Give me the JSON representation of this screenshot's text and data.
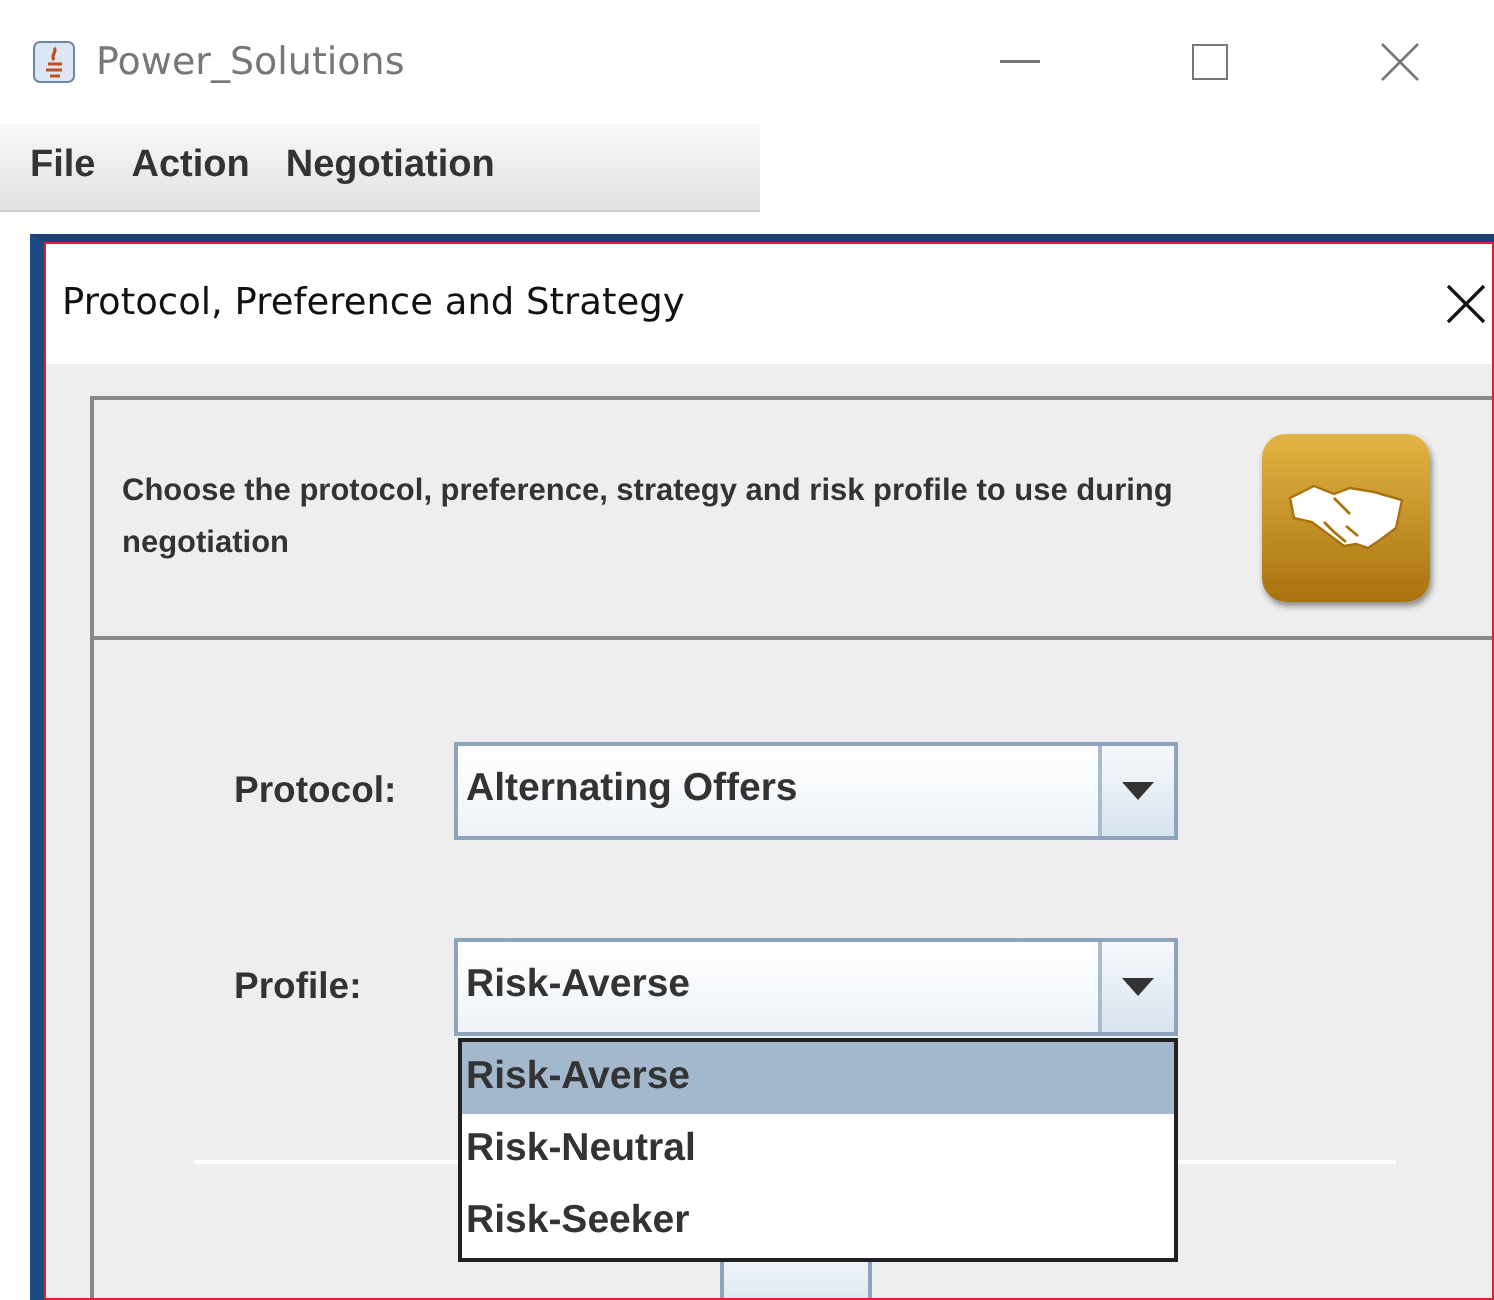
{
  "window": {
    "title": "Power_Solutions"
  },
  "menu": [
    "File",
    "Action",
    "Negotiation"
  ],
  "dialog": {
    "title": "Protocol, Preference and Strategy",
    "description": "Choose the protocol, preference, strategy and risk profile to use during negotiation",
    "fields": [
      {
        "label": "Protocol:",
        "value": "Alternating Offers"
      },
      {
        "label": "Profile:",
        "value": "Risk-Averse",
        "options": [
          {
            "label": "Risk-Averse",
            "selected": true
          },
          {
            "label": "Risk-Neutral",
            "selected": false
          },
          {
            "label": "Risk-Seeker",
            "selected": false
          }
        ]
      }
    ]
  }
}
